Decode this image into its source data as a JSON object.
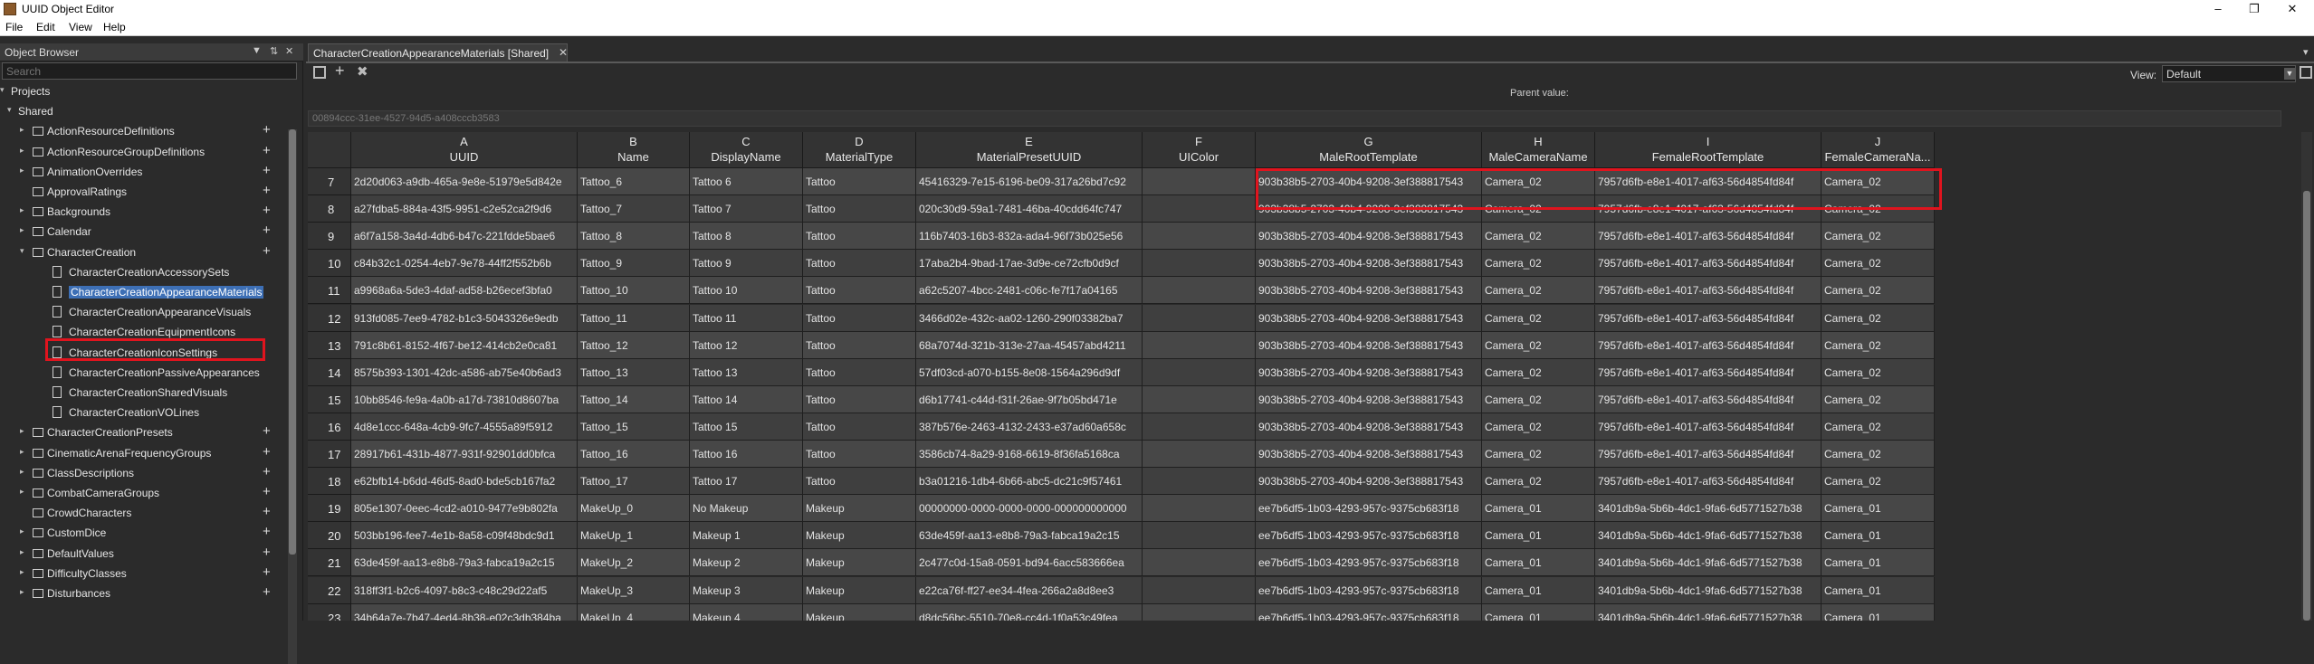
{
  "window": {
    "title": "UUID Object Editor"
  },
  "menu": [
    "File",
    "Edit",
    "View",
    "Help"
  ],
  "object_browser": {
    "title": "Object Browser",
    "search_placeholder": "Search",
    "tree": [
      {
        "label": "Projects",
        "level": 0,
        "expanded": true,
        "type": "folder"
      },
      {
        "label": "Shared",
        "level": 1,
        "expanded": true,
        "type": "folder"
      },
      {
        "label": "ActionResourceDefinitions",
        "level": 2,
        "expanded": false,
        "type": "folder",
        "addable": true
      },
      {
        "label": "ActionResourceGroupDefinitions",
        "level": 2,
        "expanded": false,
        "type": "folder",
        "addable": true
      },
      {
        "label": "AnimationOverrides",
        "level": 2,
        "expanded": false,
        "type": "folder",
        "addable": true
      },
      {
        "label": "ApprovalRatings",
        "level": 2,
        "expanded": false,
        "type": "folder-leaf",
        "addable": true
      },
      {
        "label": "Backgrounds",
        "level": 2,
        "expanded": false,
        "type": "folder",
        "addable": true
      },
      {
        "label": "Calendar",
        "level": 2,
        "expanded": false,
        "type": "folder",
        "addable": true
      },
      {
        "label": "CharacterCreation",
        "level": 2,
        "expanded": true,
        "type": "folder",
        "addable": true
      },
      {
        "label": "CharacterCreationAccessorySets",
        "level": 3,
        "type": "doc"
      },
      {
        "label": "CharacterCreationAppearanceMaterials",
        "level": 3,
        "type": "doc",
        "selected": true
      },
      {
        "label": "CharacterCreationAppearanceVisuals",
        "level": 3,
        "type": "doc"
      },
      {
        "label": "CharacterCreationEquipmentIcons",
        "level": 3,
        "type": "doc"
      },
      {
        "label": "CharacterCreationIconSettings",
        "level": 3,
        "type": "doc"
      },
      {
        "label": "CharacterCreationPassiveAppearances",
        "level": 3,
        "type": "doc"
      },
      {
        "label": "CharacterCreationSharedVisuals",
        "level": 3,
        "type": "doc"
      },
      {
        "label": "CharacterCreationVOLines",
        "level": 3,
        "type": "doc"
      },
      {
        "label": "CharacterCreationPresets",
        "level": 2,
        "expanded": false,
        "type": "folder",
        "addable": true
      },
      {
        "label": "CinematicArenaFrequencyGroups",
        "level": 2,
        "expanded": false,
        "type": "folder",
        "addable": true
      },
      {
        "label": "ClassDescriptions",
        "level": 2,
        "expanded": false,
        "type": "folder",
        "addable": true
      },
      {
        "label": "CombatCameraGroups",
        "level": 2,
        "expanded": false,
        "type": "folder",
        "addable": true
      },
      {
        "label": "CrowdCharacters",
        "level": 2,
        "expanded": false,
        "type": "folder-leaf",
        "addable": true
      },
      {
        "label": "CustomDice",
        "level": 2,
        "expanded": false,
        "type": "folder",
        "addable": true
      },
      {
        "label": "DefaultValues",
        "level": 2,
        "expanded": false,
        "type": "folder",
        "addable": true
      },
      {
        "label": "DifficultyClasses",
        "level": 2,
        "expanded": false,
        "type": "folder",
        "addable": true
      },
      {
        "label": "Disturbances",
        "level": 2,
        "expanded": false,
        "type": "folder",
        "addable": true
      }
    ]
  },
  "editor": {
    "tab_label": "CharacterCreationAppearanceMaterials [Shared]",
    "view_label": "View:",
    "view_value": "Default",
    "parent_value_label": "Parent value:",
    "uuid_value": "00894ccc-31ee-4527-94d5-a408cccb3583",
    "columns": [
      {
        "letter": "A",
        "name": "UUID"
      },
      {
        "letter": "B",
        "name": "Name"
      },
      {
        "letter": "C",
        "name": "DisplayName"
      },
      {
        "letter": "D",
        "name": "MaterialType"
      },
      {
        "letter": "E",
        "name": "MaterialPresetUUID"
      },
      {
        "letter": "F",
        "name": "UIColor"
      },
      {
        "letter": "G",
        "name": "MaleRootTemplate"
      },
      {
        "letter": "H",
        "name": "MaleCameraName"
      },
      {
        "letter": "I",
        "name": "FemaleRootTemplate"
      },
      {
        "letter": "J",
        "name": "FemaleCameraNa..."
      }
    ],
    "rows": [
      {
        "num": "7",
        "cells": [
          "2d20d063-a9db-465a-9e8e-51979e5d842e",
          "Tattoo_6",
          "Tattoo 6",
          "Tattoo",
          "45416329-7e15-6196-be09-317a26bd7c92",
          "",
          "903b38b5-2703-40b4-9208-3ef388817543",
          "Camera_02",
          "7957d6fb-e8e1-4017-af63-56d4854fd84f",
          "Camera_02"
        ]
      },
      {
        "num": "8",
        "cells": [
          "a27fdba5-884a-43f5-9951-c2e52ca2f9d6",
          "Tattoo_7",
          "Tattoo 7",
          "Tattoo",
          "020c30d9-59a1-7481-46ba-40cdd64fc747",
          "",
          "903b38b5-2703-40b4-9208-3ef388817543",
          "Camera_02",
          "7957d6fb-e8e1-4017-af63-56d4854fd84f",
          "Camera_02"
        ]
      },
      {
        "num": "9",
        "cells": [
          "a6f7a158-3a4d-4db6-b47c-221fdde5bae6",
          "Tattoo_8",
          "Tattoo 8",
          "Tattoo",
          "116b7403-16b3-832a-ada4-96f73b025e56",
          "",
          "903b38b5-2703-40b4-9208-3ef388817543",
          "Camera_02",
          "7957d6fb-e8e1-4017-af63-56d4854fd84f",
          "Camera_02"
        ]
      },
      {
        "num": "10",
        "cells": [
          "c84b32c1-0254-4eb7-9e78-44ff2f552b6b",
          "Tattoo_9",
          "Tattoo 9",
          "Tattoo",
          "17aba2b4-9bad-17ae-3d9e-ce72cfb0d9cf",
          "",
          "903b38b5-2703-40b4-9208-3ef388817543",
          "Camera_02",
          "7957d6fb-e8e1-4017-af63-56d4854fd84f",
          "Camera_02"
        ]
      },
      {
        "num": "11",
        "cells": [
          "a9968a6a-5de3-4daf-ad58-b26ecef3bfa0",
          "Tattoo_10",
          "Tattoo 10",
          "Tattoo",
          "a62c5207-4bcc-2481-c06c-fe7f17a04165",
          "",
          "903b38b5-2703-40b4-9208-3ef388817543",
          "Camera_02",
          "7957d6fb-e8e1-4017-af63-56d4854fd84f",
          "Camera_02"
        ]
      },
      {
        "num": "12",
        "cells": [
          "913fd085-7ee9-4782-b1c3-5043326e9edb",
          "Tattoo_11",
          "Tattoo 11",
          "Tattoo",
          "3466d02e-432c-aa02-1260-290f03382ba7",
          "",
          "903b38b5-2703-40b4-9208-3ef388817543",
          "Camera_02",
          "7957d6fb-e8e1-4017-af63-56d4854fd84f",
          "Camera_02"
        ]
      },
      {
        "num": "13",
        "cells": [
          "791c8b61-8152-4f67-be12-414cb2e0ca81",
          "Tattoo_12",
          "Tattoo 12",
          "Tattoo",
          "68a7074d-321b-313e-27aa-45457abd4211",
          "",
          "903b38b5-2703-40b4-9208-3ef388817543",
          "Camera_02",
          "7957d6fb-e8e1-4017-af63-56d4854fd84f",
          "Camera_02"
        ]
      },
      {
        "num": "14",
        "cells": [
          "8575b393-1301-42dc-a586-ab75e40b6ad3",
          "Tattoo_13",
          "Tattoo 13",
          "Tattoo",
          "57df03cd-a070-b155-8e08-1564a296d9df",
          "",
          "903b38b5-2703-40b4-9208-3ef388817543",
          "Camera_02",
          "7957d6fb-e8e1-4017-af63-56d4854fd84f",
          "Camera_02"
        ]
      },
      {
        "num": "15",
        "cells": [
          "10bb8546-fe9a-4a0b-a17d-73810d8607ba",
          "Tattoo_14",
          "Tattoo 14",
          "Tattoo",
          "d6b17741-c44d-f31f-26ae-9f7b05bd471e",
          "",
          "903b38b5-2703-40b4-9208-3ef388817543",
          "Camera_02",
          "7957d6fb-e8e1-4017-af63-56d4854fd84f",
          "Camera_02"
        ]
      },
      {
        "num": "16",
        "cells": [
          "4d8e1ccc-648a-4cb9-9fc7-4555a89f5912",
          "Tattoo_15",
          "Tattoo 15",
          "Tattoo",
          "387b576e-2463-4132-2433-e37ad60a658c",
          "",
          "903b38b5-2703-40b4-9208-3ef388817543",
          "Camera_02",
          "7957d6fb-e8e1-4017-af63-56d4854fd84f",
          "Camera_02"
        ]
      },
      {
        "num": "17",
        "cells": [
          "28917b61-431b-4877-931f-92901dd0bfca",
          "Tattoo_16",
          "Tattoo 16",
          "Tattoo",
          "3586cb74-8a29-9168-6619-8f36fa5168ca",
          "",
          "903b38b5-2703-40b4-9208-3ef388817543",
          "Camera_02",
          "7957d6fb-e8e1-4017-af63-56d4854fd84f",
          "Camera_02"
        ]
      },
      {
        "num": "18",
        "cells": [
          "e62bfb14-b6dd-46d5-8ad0-bde5cb167fa2",
          "Tattoo_17",
          "Tattoo 17",
          "Tattoo",
          "b3a01216-1db4-6b66-abc5-dc21c9f57461",
          "",
          "903b38b5-2703-40b4-9208-3ef388817543",
          "Camera_02",
          "7957d6fb-e8e1-4017-af63-56d4854fd84f",
          "Camera_02"
        ]
      },
      {
        "num": "19",
        "cells": [
          "805e1307-0eec-4cd2-a010-9477e9b802fa",
          "MakeUp_0",
          "No Makeup",
          "Makeup",
          "00000000-0000-0000-0000-000000000000",
          "",
          "ee7b6df5-1b03-4293-957c-9375cb683f18",
          "Camera_01",
          "3401db9a-5b6b-4dc1-9fa6-6d5771527b38",
          "Camera_01"
        ]
      },
      {
        "num": "20",
        "cells": [
          "503bb196-fee7-4e1b-8a58-c09f48bdc9d1",
          "MakeUp_1",
          "Makeup 1",
          "Makeup",
          "63de459f-aa13-e8b8-79a3-fabca19a2c15",
          "",
          "ee7b6df5-1b03-4293-957c-9375cb683f18",
          "Camera_01",
          "3401db9a-5b6b-4dc1-9fa6-6d5771527b38",
          "Camera_01"
        ]
      },
      {
        "num": "21",
        "cells": [
          "63de459f-aa13-e8b8-79a3-fabca19a2c15",
          "MakeUp_2",
          "Makeup 2",
          "Makeup",
          "2c477c0d-15a8-0591-bd94-6acc583666ea",
          "",
          "ee7b6df5-1b03-4293-957c-9375cb683f18",
          "Camera_01",
          "3401db9a-5b6b-4dc1-9fa6-6d5771527b38",
          "Camera_01"
        ]
      },
      {
        "num": "22",
        "cells": [
          "318ff3f1-b2c6-4097-b8c3-c48c29d22af5",
          "MakeUp_3",
          "Makeup 3",
          "Makeup",
          "e22ca76f-ff27-ee34-4fea-266a2a8d8ee3",
          "",
          "ee7b6df5-1b03-4293-957c-9375cb683f18",
          "Camera_01",
          "3401db9a-5b6b-4dc1-9fa6-6d5771527b38",
          "Camera_01"
        ]
      },
      {
        "num": "23",
        "cells": [
          "34b64a7e-7b47-4ed4-8b38-e02c3db384ba",
          "MakeUp_4",
          "Makeup 4",
          "Makeup",
          "d8dc56bc-5510-70e8-cc4d-1f0a53c49fea",
          "",
          "ee7b6df5-1b03-4293-957c-9375cb683f18",
          "Camera_01",
          "3401db9a-5b6b-4dc1-9fa6-6d5771527b38",
          "Camera_01"
        ]
      }
    ]
  },
  "colors": {
    "selection": "#3d6fb5",
    "highlight_box": "#e0141e",
    "background": "#2b2b2b"
  }
}
